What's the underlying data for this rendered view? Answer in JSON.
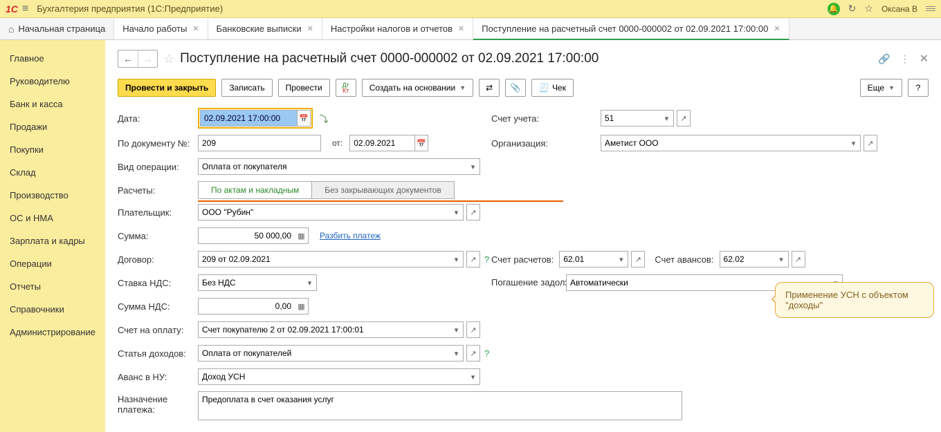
{
  "topbar": {
    "app_title": "Бухгалтерия предприятия  (1С:Предприятие)",
    "user": "Оксана В"
  },
  "tabs": {
    "home": "Начальная страница",
    "items": [
      {
        "label": "Начало работы"
      },
      {
        "label": "Банковские выписки"
      },
      {
        "label": "Настройки налогов и отчетов"
      },
      {
        "label": "Поступление на расчетный счет 0000-000002 от 02.09.2021 17:00:00",
        "active": true
      }
    ]
  },
  "sidebar": {
    "items": [
      "Главное",
      "Руководителю",
      "Банк и касса",
      "Продажи",
      "Покупки",
      "Склад",
      "Производство",
      "ОС и НМА",
      "Зарплата и кадры",
      "Операции",
      "Отчеты",
      "Справочники",
      "Администрирование"
    ]
  },
  "page": {
    "title": "Поступление на расчетный счет 0000-000002 от 02.09.2021 17:00:00"
  },
  "toolbar": {
    "primary": "Провести и закрыть",
    "write": "Записать",
    "post": "Провести",
    "create_on_basis": "Создать на основании",
    "check": "Чек",
    "more": "Еще",
    "help": "?"
  },
  "form": {
    "date_label": "Дата:",
    "date_value": "02.09.2021 17:00:00",
    "account_label": "Счет учета:",
    "account_value": "51",
    "docnum_label": "По документу №:",
    "docnum_value": "209",
    "docnum_from": "от:",
    "docnum_date": "02.09.2021",
    "org_label": "Организация:",
    "org_value": "Аметист ООО",
    "op_label": "Вид операции:",
    "op_value": "Оплата от покупателя",
    "calc_label": "Расчеты:",
    "calc_seg1": "По актам и накладным",
    "calc_seg2": "Без закрывающих документов",
    "payer_label": "Плательщик:",
    "payer_value": "ООО \"Рубин\"",
    "sum_label": "Сумма:",
    "sum_value": "50 000,00",
    "split_link": "Разбить платеж",
    "contract_label": "Договор:",
    "contract_value": "209 от 02.09.2021",
    "settle_label": "Счет расчетов:",
    "settle_value": "62.01",
    "advance_label": "Счет авансов:",
    "advance_value": "62.02",
    "vat_rate_label": "Ставка НДС:",
    "vat_rate_value": "Без НДС",
    "debt_label": "Погашение задолженности:",
    "debt_value": "Автоматически",
    "vat_sum_label": "Сумма НДС:",
    "vat_sum_value": "0,00",
    "invoice_label": "Счет на оплату:",
    "invoice_value": "Счет покупателю 2 от 02.09.2021 17:00:01",
    "income_label": "Статья доходов:",
    "income_value": "Оплата от покупателей",
    "advance_nu_label": "Аванс в НУ:",
    "advance_nu_value": "Доход УСН",
    "purpose_label": "Назначение платежа:",
    "purpose_value": "Предоплата в счет оказания услуг"
  },
  "bubble": "Применение УСН с объектом \"доходы\""
}
